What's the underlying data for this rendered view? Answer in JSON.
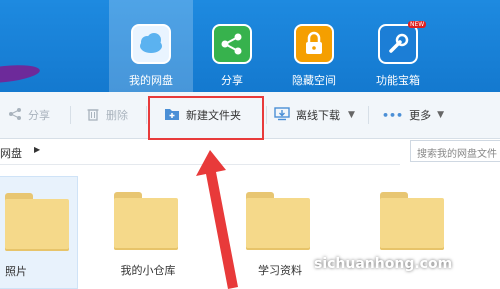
{
  "nav": {
    "items": [
      {
        "label": "我的网盘",
        "icon": "cloud-icon",
        "color": "#9fd3ff"
      },
      {
        "label": "分享",
        "icon": "share-icon",
        "color": "#37b24d"
      },
      {
        "label": "隐藏空间",
        "icon": "lock-icon",
        "color": "#f59f00"
      },
      {
        "label": "功能宝箱",
        "icon": "toolbox-icon",
        "color": "#1c7ed6",
        "badge": "NEW"
      }
    ]
  },
  "toolbar": {
    "share_label": "分享",
    "delete_label": "删除",
    "new_folder_label": "新建文件夹",
    "offline_download_label": "离线下载",
    "more_label": "更多"
  },
  "address": {
    "path": "网盘"
  },
  "search": {
    "placeholder": "搜索我的网盘文件"
  },
  "folders": [
    {
      "label": "照片"
    },
    {
      "label": "我的小仓库"
    },
    {
      "label": ""
    },
    {
      "label": "学习资料"
    },
    {
      "label": ""
    }
  ],
  "watermark": "sichuanhong.com"
}
